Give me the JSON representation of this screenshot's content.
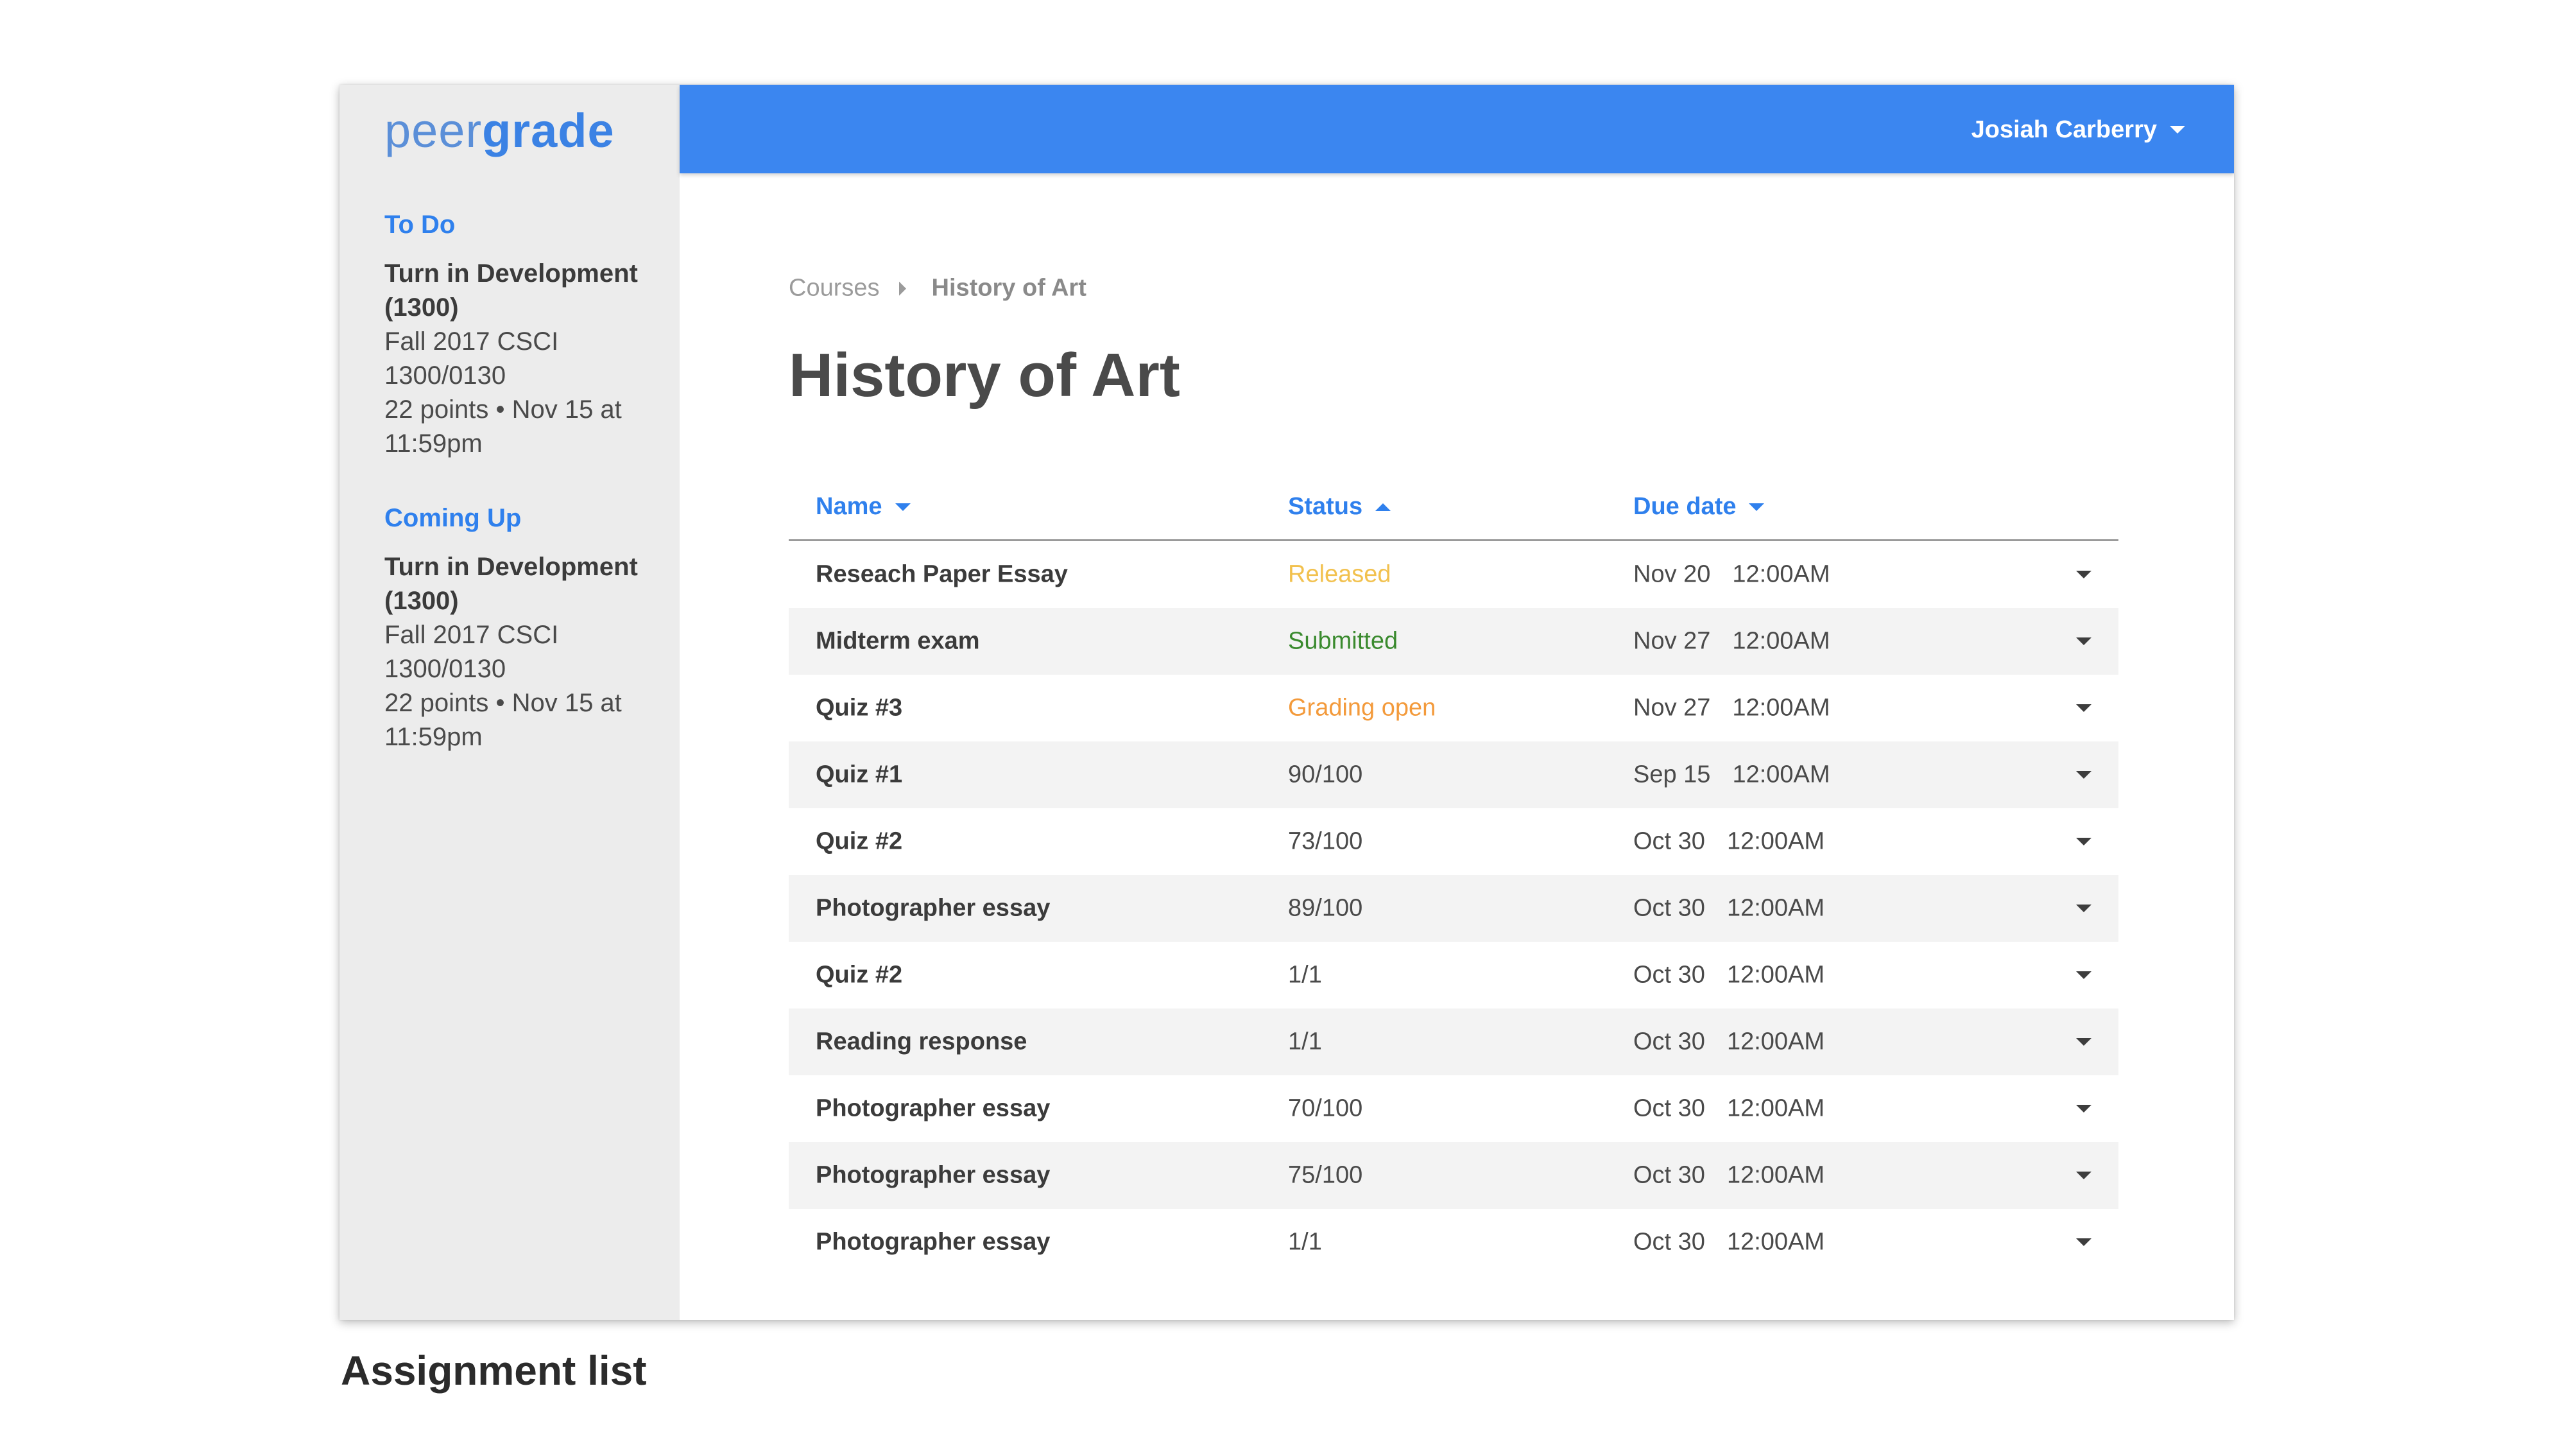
{
  "app": {
    "logo": {
      "light": "peer",
      "bold": "grade"
    },
    "user": {
      "name": "Josiah Carberry"
    }
  },
  "sidebar": {
    "todo": {
      "heading": "To Do",
      "item": {
        "title_line1": "Turn in Development",
        "title_line2": "(1300)",
        "course_line1": "Fall 2017 CSCI",
        "course_line2": "1300/0130",
        "meta_line1": "22 points • Nov 15 at",
        "meta_line2": "11:59pm"
      }
    },
    "coming_up": {
      "heading": "Coming Up",
      "item": {
        "title_line1": "Turn in Development",
        "title_line2": "(1300)",
        "course_line1": "Fall 2017 CSCI",
        "course_line2": "1300/0130",
        "meta_line1": "22 points • Nov 15 at",
        "meta_line2": "11:59pm"
      }
    }
  },
  "breadcrumb": {
    "courses": "Courses",
    "current": "History of Art"
  },
  "page": {
    "title": "History of Art"
  },
  "table": {
    "headers": {
      "name": "Name",
      "status": "Status",
      "due": "Due date"
    },
    "rows": [
      {
        "name": "Reseach Paper Essay",
        "status": "Released",
        "status_color": "#f2c14e",
        "due_date": "Nov 20",
        "due_time": "12:00AM"
      },
      {
        "name": "Midterm exam",
        "status": "Submitted",
        "status_color": "#3a8a2e",
        "due_date": "Nov 27",
        "due_time": "12:00AM"
      },
      {
        "name": "Quiz #3",
        "status": "Grading open",
        "status_color": "#f39a3b",
        "due_date": "Nov 27",
        "due_time": "12:00AM"
      },
      {
        "name": "Quiz #1",
        "status": "90/100",
        "status_color": "#4a4a4a",
        "due_date": "Sep 15",
        "due_time": "12:00AM"
      },
      {
        "name": "Quiz #2",
        "status": "73/100",
        "status_color": "#4a4a4a",
        "due_date": "Oct 30",
        "due_time": "12:00AM"
      },
      {
        "name": "Photographer essay",
        "status": "89/100",
        "status_color": "#4a4a4a",
        "due_date": "Oct 30",
        "due_time": "12:00AM"
      },
      {
        "name": "Quiz #2",
        "status": "1/1",
        "status_color": "#4a4a4a",
        "due_date": "Oct 30",
        "due_time": "12:00AM"
      },
      {
        "name": "Reading response",
        "status": "1/1",
        "status_color": "#4a4a4a",
        "due_date": "Oct 30",
        "due_time": "12:00AM"
      },
      {
        "name": "Photographer essay",
        "status": "70/100",
        "status_color": "#4a4a4a",
        "due_date": "Oct 30",
        "due_time": "12:00AM"
      },
      {
        "name": "Photographer essay",
        "status": "75/100",
        "status_color": "#4a4a4a",
        "due_date": "Oct 30",
        "due_time": "12:00AM"
      },
      {
        "name": "Photographer essay",
        "status": "1/1",
        "status_color": "#4a4a4a",
        "due_date": "Oct 30",
        "due_time": "12:00AM"
      }
    ]
  },
  "caption": "Assignment list",
  "icons": {
    "user_menu": "caret-down-icon",
    "breadcrumb_separator": "caret-right-icon",
    "sort_name": "caret-down-icon",
    "sort_status": "caret-up-icon",
    "sort_due": "caret-down-icon",
    "row_toggle": "caret-down-icon"
  },
  "colors": {
    "accent": "#3b86f0",
    "link": "#2f80ed",
    "sidebar_bg": "#ececec",
    "row_shade": "#f3f3f3"
  }
}
